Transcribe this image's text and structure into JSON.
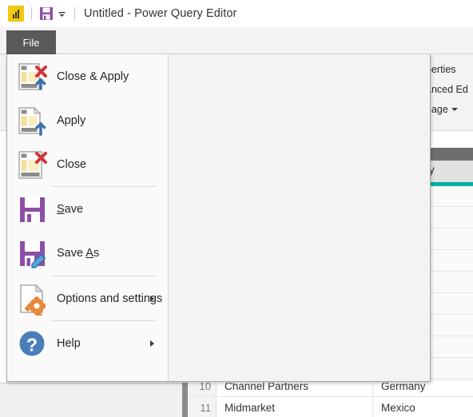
{
  "titlebar": {
    "app_icon": "power-bi-icon",
    "save_icon": "save-icon",
    "dropdown_icon": "chevron-down-icon",
    "title": "Untitled - Power Query Editor"
  },
  "ribbon": {
    "file_tab": "File",
    "visible_fragments": [
      {
        "text": "perties",
        "full": "Properties"
      },
      {
        "text": "anced Ed",
        "full": "Advanced Editor"
      },
      {
        "text": "nage",
        "full": "Manage",
        "has_caret": true
      }
    ]
  },
  "file_menu": {
    "items": [
      {
        "label": "Close & Apply",
        "icon": "close-and-apply-icon",
        "accel": "",
        "submenu": false
      },
      {
        "label": "Apply",
        "icon": "apply-icon",
        "accel": "",
        "submenu": false
      },
      {
        "label": "Close",
        "icon": "close-icon",
        "accel": "",
        "submenu": false
      },
      {
        "label": "Save",
        "icon": "save-icon",
        "accel": "S",
        "submenu": false
      },
      {
        "label": "Save As",
        "icon": "save-as-icon",
        "accel": "A",
        "submenu": false
      },
      {
        "label": "Options and settings",
        "icon": "options-and-settings-icon",
        "accel": "",
        "submenu": true
      },
      {
        "label": "Help",
        "icon": "help-icon",
        "accel": "",
        "submenu": true
      }
    ]
  },
  "column_header": {
    "visible_text": "y",
    "accent_color": "#00b0a0"
  },
  "data_grid": {
    "rows": [
      {
        "num": "10",
        "col1": "Channel Partners",
        "col2": "Germany"
      },
      {
        "num": "11",
        "col1": "Midmarket",
        "col2": "Mexico"
      }
    ]
  },
  "colors": {
    "brand_yellow": "#f2c811",
    "save_purple": "#8c4fa8",
    "accent_teal": "#00b0a0",
    "tab_dark": "#595959",
    "help_blue": "#4a7ebb",
    "gear_orange": "#e8883a",
    "close_red": "#d13438",
    "arrow_blue": "#3a6fb0"
  }
}
